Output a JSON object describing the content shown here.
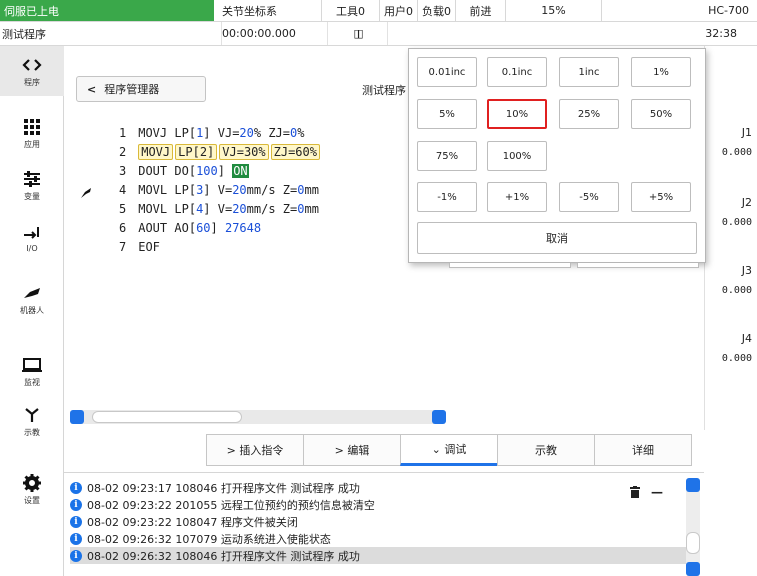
{
  "status_bar": {
    "power": "伺服已上电",
    "coord": "关节坐标系",
    "tool": "工具0",
    "user": "用户0",
    "load": "负载0",
    "direction": "前进",
    "speed": "15%",
    "model": "HC-700"
  },
  "sub_bar": {
    "program": "测试程序",
    "elapsed": "00:00:00.000",
    "pause_glyph": "▯▯",
    "clock_tail": "32:38"
  },
  "sidebar": {
    "items": [
      {
        "label": "程序",
        "icon": "code-brackets-icon",
        "glyph": "<>"
      },
      {
        "label": "应用",
        "icon": "apps-grid-icon",
        "glyph": "⠿"
      },
      {
        "label": "变量",
        "icon": "sliders-icon",
        "glyph": "⚟"
      },
      {
        "label": "I/O",
        "icon": "io-arrow-icon",
        "glyph": "⇥"
      },
      {
        "label": "机器人",
        "icon": "robot-arm-icon",
        "glyph": "◣"
      },
      {
        "label": "监视",
        "icon": "monitor-icon",
        "glyph": "▭"
      },
      {
        "label": "示教",
        "icon": "teach-pendant-icon",
        "glyph": "Y"
      },
      {
        "label": "设置",
        "icon": "gear-icon",
        "glyph": "⚙"
      }
    ]
  },
  "editor": {
    "manager_button": "程序管理器",
    "back_glyph": "<",
    "program_name": "测试程序",
    "lines": [
      {
        "no": "1",
        "text": "MOVJ LP[1] VJ=20% ZJ=0%"
      },
      {
        "no": "2",
        "tokens": [
          "MOVJ",
          "LP[2]",
          "VJ=30%",
          "ZJ=60%"
        ]
      },
      {
        "no": "3",
        "text": "DOUT DO[100] ON"
      },
      {
        "no": "4",
        "text": "MOVL LP[3] V=20mm/s Z=0mm"
      },
      {
        "no": "5",
        "text": "MOVL LP[4] V=20mm/s Z=0mm"
      },
      {
        "no": "6",
        "text": "AOUT AO[60] 27648"
      },
      {
        "no": "7",
        "text": "EOF"
      }
    ],
    "line1": {
      "op": "MOVJ",
      "lp": "LP[",
      "lpn": "1",
      "rest1": "] VJ=",
      "vj": "20",
      "rest2": "% ZJ=",
      "zj": "0",
      "rest3": "%"
    },
    "line3": {
      "op": "DOUT",
      "do": "DO[",
      "don": "100",
      "rest": "] ",
      "state": "ON"
    },
    "line4": {
      "op": "MOVL",
      "lp": "LP[",
      "lpn": "3",
      "rest1": "] V=",
      "v": "20",
      "rest2": "mm/s Z=",
      "z": "0",
      "rest3": "mm"
    },
    "line5": {
      "op": "MOVL",
      "lp": "LP[",
      "lpn": "4",
      "rest1": "] V=",
      "v": "20",
      "rest2": "mm/s Z=",
      "z": "0",
      "rest3": "mm"
    },
    "line6": {
      "op": "AOUT",
      "ao": "AO[",
      "aon": "60",
      "rest": "] ",
      "val": "27648"
    },
    "line7": {
      "op": "EOF"
    }
  },
  "joints": [
    {
      "name": "J1",
      "value": "0.000"
    },
    {
      "name": "J2",
      "value": "0.000"
    },
    {
      "name": "J3",
      "value": "0.000"
    },
    {
      "name": "J4",
      "value": "0.000"
    }
  ],
  "toolbar": {
    "insert": "> 插入指令",
    "edit": "> 编辑",
    "debug": "⌄ 调试",
    "teach": "示教",
    "detail": "详细"
  },
  "log": {
    "info_glyph": "i",
    "entries": [
      "08-02 09:23:17 108046 打开程序文件 测试程序 成功",
      "08-02 09:23:22 201055 远程工位预约的预约信息被清空",
      "08-02 09:23:22 108047 程序文件被关闭",
      "08-02 09:26:32 107079 运动系统进入使能状态",
      "08-02 09:26:32 108046 打开程序文件 测试程序 成功"
    ],
    "delete_glyph": "🗑",
    "minimize_glyph": "—"
  },
  "increment_popup": {
    "rows": [
      [
        "0.01inc",
        "0.1inc",
        "1inc",
        "1%"
      ],
      [
        "5%",
        "10%",
        "25%",
        "50%"
      ],
      [
        "75%",
        "100%"
      ],
      [
        "-1%",
        "+1%",
        "-5%",
        "+5%"
      ]
    ],
    "selected": "10%",
    "cancel": "取消"
  },
  "colors": {
    "power_green": "#3aa84a",
    "accent_blue": "#1f73e8",
    "selected_red": "#e02020",
    "number_blue": "#1a4fd8",
    "token_yellow": "#fff7c9"
  }
}
